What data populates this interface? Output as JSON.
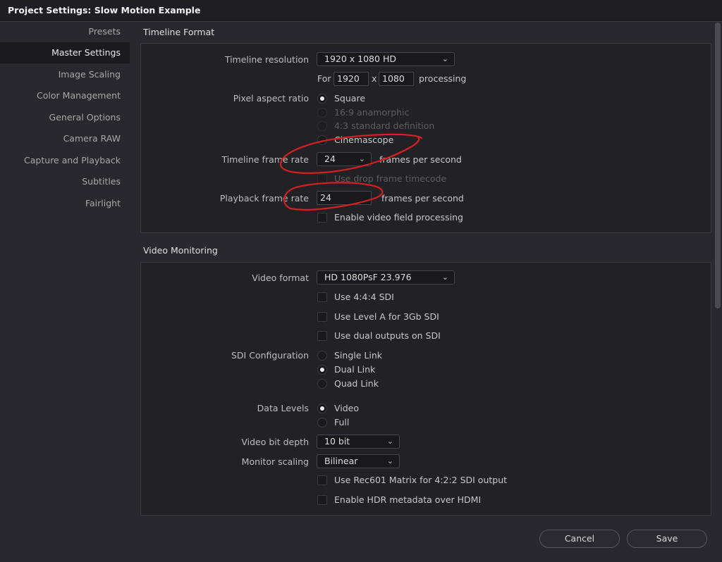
{
  "window": {
    "title": "Project Settings:  Slow Motion Example"
  },
  "sidebar": {
    "items": [
      {
        "label": "Presets"
      },
      {
        "label": "Master Settings",
        "active": true
      },
      {
        "label": "Image Scaling"
      },
      {
        "label": "Color Management"
      },
      {
        "label": "General Options"
      },
      {
        "label": "Camera RAW"
      },
      {
        "label": "Capture and Playback"
      },
      {
        "label": "Subtitles"
      },
      {
        "label": "Fairlight"
      }
    ]
  },
  "timeline_format": {
    "title": "Timeline Format",
    "resolution_label": "Timeline resolution",
    "resolution_value": "1920 x 1080 HD",
    "for_label": "For",
    "width_value": "1920",
    "x_label": "x",
    "height_value": "1080",
    "processing_label": "processing",
    "pixel_aspect_label": "Pixel aspect ratio",
    "pixel_aspect_options": [
      {
        "label": "Square",
        "selected": true,
        "enabled": true
      },
      {
        "label": "16:9 anamorphic",
        "selected": false,
        "enabled": false
      },
      {
        "label": "4:3 standard definition",
        "selected": false,
        "enabled": false
      },
      {
        "label": "Cinemascope",
        "selected": false,
        "enabled": true
      }
    ],
    "frame_rate_label": "Timeline frame rate",
    "frame_rate_value": "24",
    "fps_label": "frames per second",
    "drop_frame_label": "Use drop frame timecode",
    "playback_rate_label": "Playback frame rate",
    "playback_rate_value": "24",
    "playback_fps_label": "frames per second",
    "field_processing_label": "Enable video field processing"
  },
  "video_monitoring": {
    "title": "Video Monitoring",
    "video_format_label": "Video format",
    "video_format_value": "HD 1080PsF 23.976",
    "use444_label": "Use 4:4:4 SDI",
    "levelA_label": "Use Level A for 3Gb SDI",
    "dual_outputs_label": "Use dual outputs on SDI",
    "sdi_config_label": "SDI Configuration",
    "sdi_options": [
      {
        "label": "Single Link",
        "selected": false
      },
      {
        "label": "Dual Link",
        "selected": true
      },
      {
        "label": "Quad Link",
        "selected": false
      }
    ],
    "data_levels_label": "Data Levels",
    "data_levels_options": [
      {
        "label": "Video",
        "selected": true
      },
      {
        "label": "Full",
        "selected": false
      }
    ],
    "bit_depth_label": "Video bit depth",
    "bit_depth_value": "10 bit",
    "monitor_scaling_label": "Monitor scaling",
    "monitor_scaling_value": "Bilinear",
    "rec601_label": "Use Rec601 Matrix for 4:2:2 SDI output",
    "hdr_label": "Enable HDR metadata over HDMI"
  },
  "footer": {
    "cancel_label": "Cancel",
    "save_label": "Save"
  },
  "colors": {
    "background": "#28282e",
    "panel": "#222226",
    "annotation": "#d42020"
  }
}
